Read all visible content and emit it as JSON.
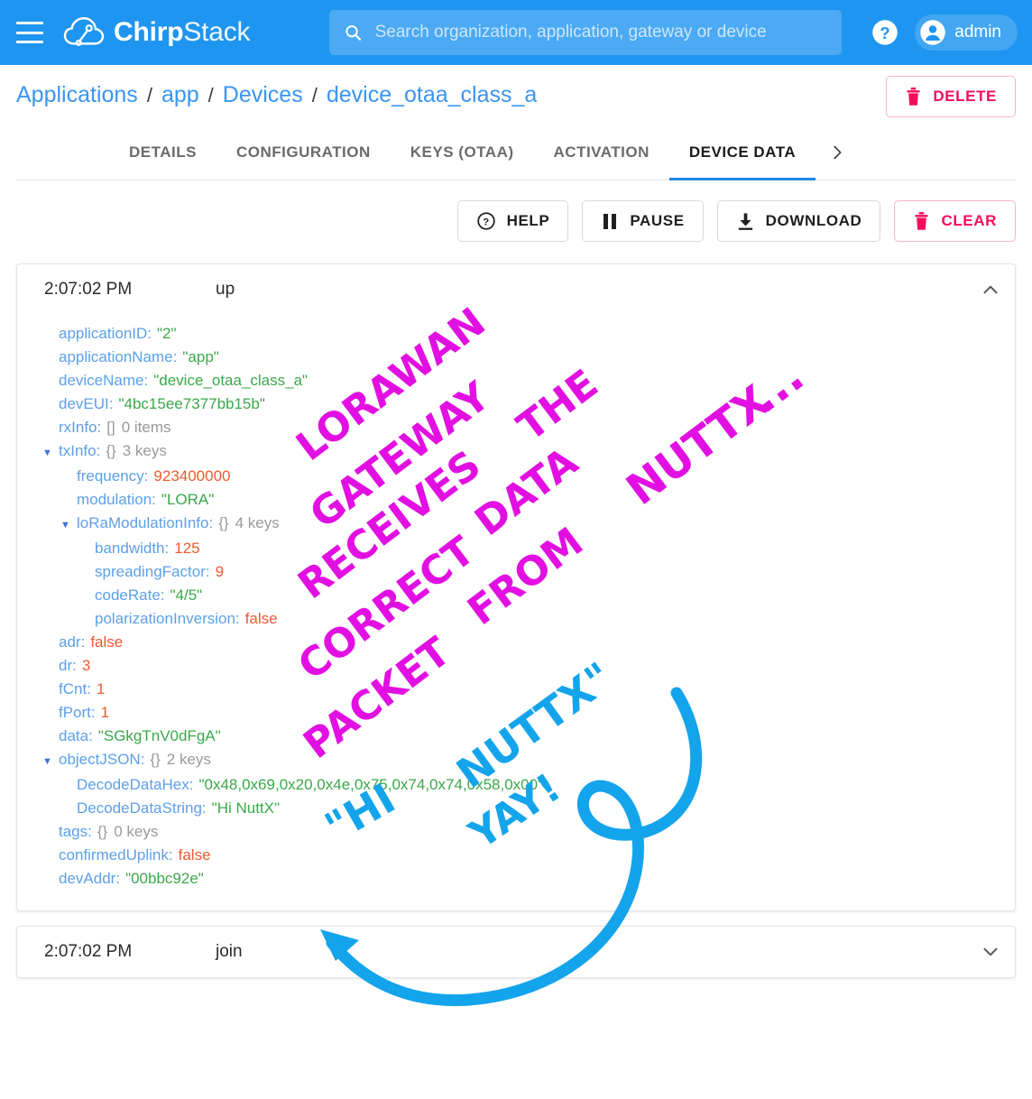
{
  "appbar": {
    "menu_icon": "hamburger-icon",
    "brand_bold": "Chirp",
    "brand_light": "Stack",
    "search": {
      "icon": "search-icon",
      "value": "",
      "placeholder": "Search organization, application, gateway or device"
    },
    "help_icon": "help-circle-icon",
    "user": {
      "avatar_icon": "account-circle-icon",
      "name": "admin"
    }
  },
  "breadcrumb": {
    "items": [
      {
        "label": "Applications"
      },
      {
        "label": "app"
      },
      {
        "label": "Devices"
      },
      {
        "label": "device_otaa_class_a"
      }
    ],
    "separator": "/"
  },
  "header_actions": {
    "delete": {
      "label": "DELETE",
      "icon": "trash-icon",
      "color": "#f50d5a"
    }
  },
  "tabs": {
    "items": [
      {
        "label": "DETAILS",
        "active": false
      },
      {
        "label": "CONFIGURATION",
        "active": false
      },
      {
        "label": "KEYS (OTAA)",
        "active": false
      },
      {
        "label": "ACTIVATION",
        "active": false
      },
      {
        "label": "DEVICE DATA",
        "active": true
      }
    ],
    "next_icon": "chevron-right-icon",
    "active_color": "#1e88e5"
  },
  "toolbar": {
    "help": {
      "label": "HELP",
      "icon": "help-circle-icon"
    },
    "pause": {
      "label": "PAUSE",
      "icon": "pause-icon"
    },
    "download": {
      "label": "DOWNLOAD",
      "icon": "download-icon"
    },
    "clear": {
      "label": "CLEAR",
      "icon": "trash-icon",
      "color": "#f50d5a"
    }
  },
  "events": [
    {
      "time": "2:07:02 PM",
      "type": "up",
      "expanded": true,
      "chevron_icon": "chevron-up-icon",
      "rows": [
        {
          "level": 0,
          "tri": "",
          "key": "applicationID",
          "brace": "",
          "meta": "",
          "value": "\"2\"",
          "vtype": "str"
        },
        {
          "level": 0,
          "tri": "",
          "key": "applicationName",
          "brace": "",
          "meta": "",
          "value": "\"app\"",
          "vtype": "str"
        },
        {
          "level": 0,
          "tri": "",
          "key": "deviceName",
          "brace": "",
          "meta": "",
          "value": "\"device_otaa_class_a\"",
          "vtype": "str"
        },
        {
          "level": 0,
          "tri": "",
          "key": "devEUI",
          "brace": "",
          "meta": "",
          "value": "\"4bc15ee7377bb15b\"",
          "vtype": "str"
        },
        {
          "level": 0,
          "tri": "",
          "key": "rxInfo",
          "brace": "[]",
          "meta": "0 items",
          "value": "",
          "vtype": "none"
        },
        {
          "level": 0,
          "tri": "▼",
          "key": "txInfo",
          "brace": "{}",
          "meta": "3 keys",
          "value": "",
          "vtype": "none"
        },
        {
          "level": 1,
          "tri": "",
          "key": "frequency",
          "brace": "",
          "meta": "",
          "value": "923400000",
          "vtype": "num"
        },
        {
          "level": 1,
          "tri": "",
          "key": "modulation",
          "brace": "",
          "meta": "",
          "value": "\"LORA\"",
          "vtype": "str"
        },
        {
          "level": 1,
          "tri": "▼",
          "key": "loRaModulationInfo",
          "brace": "{}",
          "meta": "4 keys",
          "value": "",
          "vtype": "none"
        },
        {
          "level": 2,
          "tri": "",
          "key": "bandwidth",
          "brace": "",
          "meta": "",
          "value": "125",
          "vtype": "num"
        },
        {
          "level": 2,
          "tri": "",
          "key": "spreadingFactor",
          "brace": "",
          "meta": "",
          "value": "9",
          "vtype": "num"
        },
        {
          "level": 2,
          "tri": "",
          "key": "codeRate",
          "brace": "",
          "meta": "",
          "value": "\"4/5\"",
          "vtype": "str"
        },
        {
          "level": 2,
          "tri": "",
          "key": "polarizationInversion",
          "brace": "",
          "meta": "",
          "value": "false",
          "vtype": "bool"
        },
        {
          "level": 0,
          "tri": "",
          "key": "adr",
          "brace": "",
          "meta": "",
          "value": "false",
          "vtype": "bool"
        },
        {
          "level": 0,
          "tri": "",
          "key": "dr",
          "brace": "",
          "meta": "",
          "value": "3",
          "vtype": "num"
        },
        {
          "level": 0,
          "tri": "",
          "key": "fCnt",
          "brace": "",
          "meta": "",
          "value": "1",
          "vtype": "num"
        },
        {
          "level": 0,
          "tri": "",
          "key": "fPort",
          "brace": "",
          "meta": "",
          "value": "1",
          "vtype": "num"
        },
        {
          "level": 0,
          "tri": "",
          "key": "data",
          "brace": "",
          "meta": "",
          "value": "\"SGkgTnV0dFgA\"",
          "vtype": "str"
        },
        {
          "level": 0,
          "tri": "▼",
          "key": "objectJSON",
          "brace": "{}",
          "meta": "2 keys",
          "value": "",
          "vtype": "none"
        },
        {
          "level": 1,
          "tri": "",
          "key": "DecodeDataHex",
          "brace": "",
          "meta": "",
          "value": "\"0x48,0x69,0x20,0x4e,0x75,0x74,0x74,0x58,0x00\"",
          "vtype": "str"
        },
        {
          "level": 1,
          "tri": "",
          "key": "DecodeDataString",
          "brace": "",
          "meta": "",
          "value": "\"Hi NuttX\"",
          "vtype": "str"
        },
        {
          "level": 0,
          "tri": "",
          "key": "tags",
          "brace": "{}",
          "meta": "0 keys",
          "value": "",
          "vtype": "none"
        },
        {
          "level": 0,
          "tri": "",
          "key": "confirmedUplink",
          "brace": "",
          "meta": "",
          "value": "false",
          "vtype": "bool"
        },
        {
          "level": 0,
          "tri": "",
          "key": "devAddr",
          "brace": "",
          "meta": "",
          "value": "\"00bbc92e\"",
          "vtype": "str"
        }
      ]
    },
    {
      "time": "2:07:02 PM",
      "type": "join",
      "expanded": false,
      "chevron_icon": "chevron-down-icon",
      "rows": []
    }
  ],
  "annotations": {
    "magenta_color": "#e20fe2",
    "blue_color": "#13a4ec",
    "magenta_lines": [
      "LORAWAN",
      "GATEWAY",
      "RECEIVES",
      "CORRECT",
      "PACKET",
      "THE",
      "DATA",
      "FROM",
      "NUTTX"
    ],
    "magenta_dots": "...",
    "blue_lines": [
      "\"HI",
      "NUTTX\"",
      "YAY!"
    ],
    "arrow": "curved-loop-arrow"
  }
}
